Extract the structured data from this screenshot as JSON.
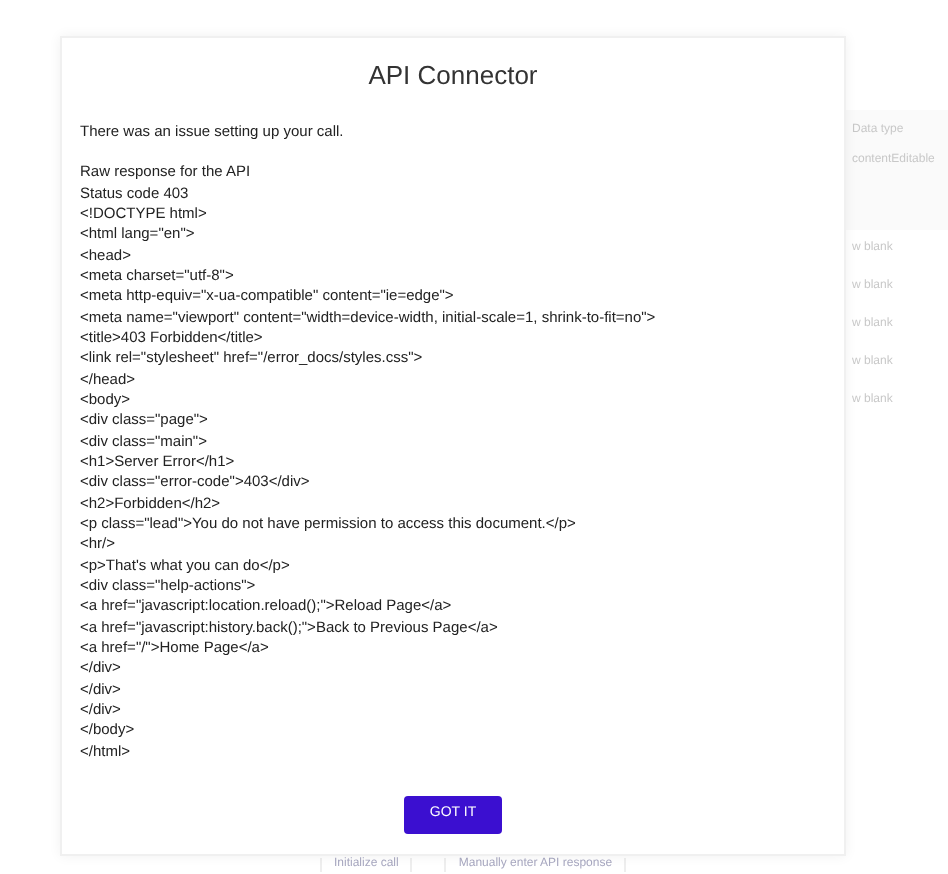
{
  "background": {
    "side_labels": [
      "Data type",
      "contentEditable"
    ],
    "side_rows": [
      "w blank",
      "w blank",
      "w blank",
      "w blank",
      "w blank"
    ],
    "bottom_buttons": [
      "Initialize call",
      "Manually enter API response"
    ]
  },
  "dialog": {
    "title": "API Connector",
    "message": "There was an issue setting up your call.",
    "response_lines": [
      "Raw response for the API",
      "Status code 403",
      "<!DOCTYPE html>",
      "<html lang=\"en\">",
      "<head>",
      "<meta charset=\"utf-8\">",
      "<meta http-equiv=\"x-ua-compatible\" content=\"ie=edge\">",
      "<meta name=\"viewport\" content=\"width=device-width, initial-scale=1, shrink-to-fit=no\">",
      "<title>403 Forbidden</title>",
      "<link rel=\"stylesheet\" href=\"/error_docs/styles.css\">",
      "</head>",
      "<body>",
      "<div class=\"page\">",
      "<div class=\"main\">",
      "<h1>Server Error</h1>",
      "<div class=\"error-code\">403</div>",
      "<h2>Forbidden</h2>",
      "<p class=\"lead\">You do not have permission to access this document.</p>",
      "<hr/>",
      "<p>That's what you can do</p>",
      "<div class=\"help-actions\">",
      "<a href=\"javascript:location.reload();\">Reload Page</a>",
      "<a href=\"javascript:history.back();\">Back to Previous Page</a>",
      "<a href=\"/\">Home Page</a>",
      "</div>",
      "</div>",
      "</div>",
      "</body>",
      "</html>"
    ],
    "button": "GOT IT"
  }
}
